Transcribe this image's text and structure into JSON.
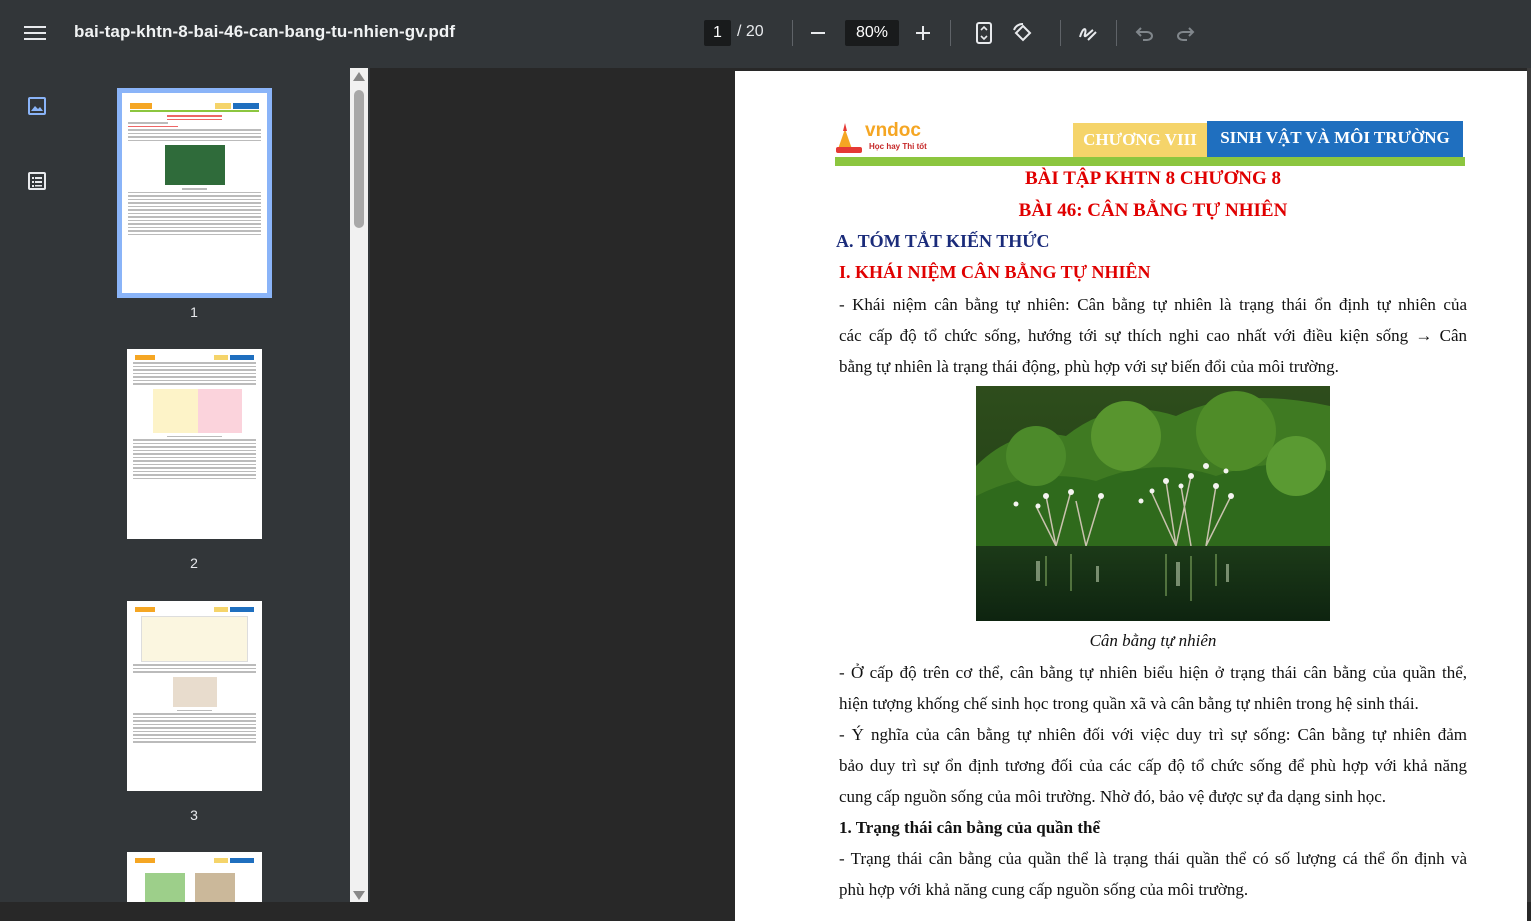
{
  "toolbar": {
    "file_name": "bai-tap-khtn-8-bai-46-can-bang-tu-nhien-gv.pdf",
    "current_page": "1",
    "total_pages": "/ 20",
    "zoom": "80%"
  },
  "thumbnails": [
    {
      "page": "1"
    },
    {
      "page": "2"
    },
    {
      "page": "3"
    }
  ],
  "document": {
    "logo_text": "vndoc",
    "logo_tagline": "Học hay Thi tốt",
    "chapter_label": "CHƯƠNG VIII",
    "chapter_title": "SINH VẬT VÀ MÔI TRƯỜNG",
    "title_1": "BÀI TẬP KHTN 8 CHƯƠNG 8",
    "title_2": "BÀI 46: CÂN BẰNG TỰ NHIÊN",
    "section_a": "A. TÓM TẮT KIẾN THỨC",
    "section_1": "I. KHÁI NIỆM CÂN BẰNG TỰ NHIÊN",
    "p1_l1": "- Khái niệm cân bằng tự nhiên: Cân bằng tự nhiên là trạng thái ổn định tự nhiên của",
    "p1_l2": "các cấp độ tổ chức sống, hướng tới sự thích nghi cao nhất với điều kiện sống → Cân",
    "p1_l3": "bằng tự nhiên là trạng thái động, phù hợp với sự biến đổi của môi trường.",
    "caption": "Cân bằng tự nhiên",
    "p2_l1": "- Ở cấp độ trên cơ thể, cân bằng tự nhiên biểu hiện ở trạng thái cân bằng của quần thể,",
    "p2_l2": "hiện tượng khống chế sinh học trong quần xã và cân bằng tự nhiên trong hệ sinh thái.",
    "p3_l1": "- Ý nghĩa của cân bằng tự nhiên đối với việc duy trì sự sống: Cân bằng tự nhiên đảm",
    "p3_l2": "bảo duy trì sự ổn định tương đối của các cấp độ tổ chức sống để phù hợp với khả năng",
    "p3_l3": "cung cấp nguồn sống của môi trường. Nhờ đó, bảo vệ được sự đa dạng sinh học.",
    "sub_1": "1. Trạng thái cân bằng của quần thể",
    "p4_l1": "- Trạng thái cân bằng của quần thể là trạng thái quần thể có số lượng cá thể ổn định và",
    "p4_l2": "phù hợp với khả năng cung cấp nguồn sống của môi trường."
  },
  "colors": {
    "toolbar_bg": "#323639",
    "viewer_bg": "#282828",
    "title_red": "#e00000",
    "section_blue": "#1a2b7a",
    "chapter_yellow": "#f5d46a",
    "chapter_blue": "#1f6fbf",
    "rule_green": "#8cc63f",
    "active_thumb": "#8ab4f8"
  },
  "icons": [
    "menu-icon",
    "zoom-out-icon",
    "zoom-in-icon",
    "fit-page-icon",
    "rotate-icon",
    "annotate-icon",
    "undo-icon",
    "redo-icon",
    "thumbnails-icon",
    "outline-icon"
  ]
}
